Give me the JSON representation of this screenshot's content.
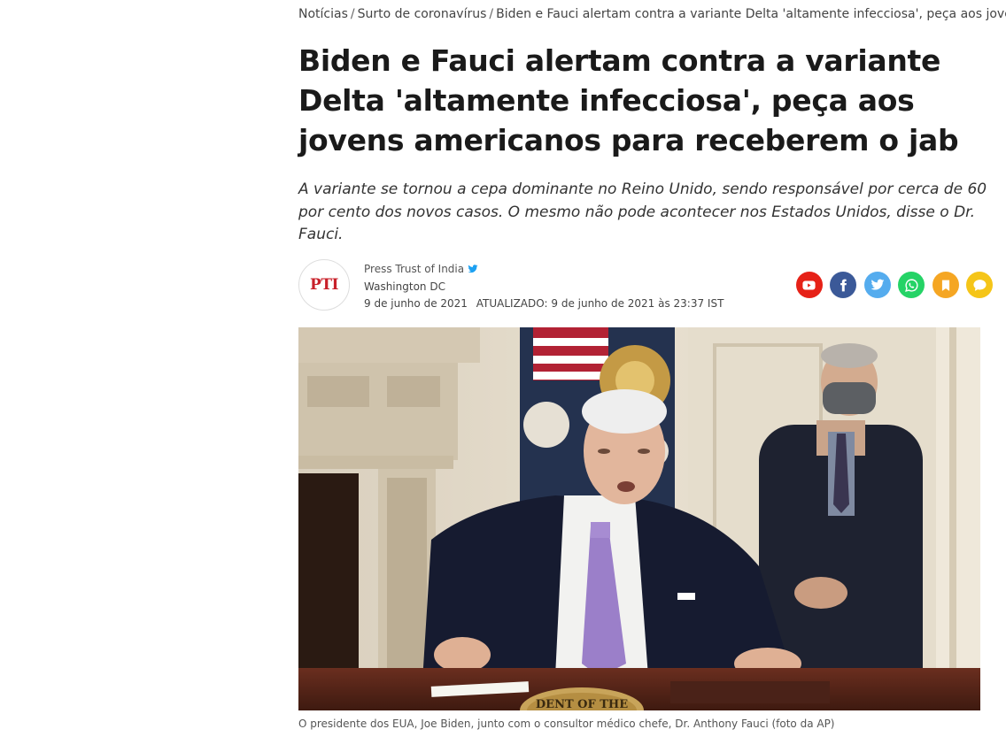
{
  "breadcrumb": {
    "items": [
      "Notícias",
      "Surto de coronavírus",
      "Biden e Fauci alertam contra a variante Delta 'altamente infecciosa', peça aos jovens americanos para receberem o jab"
    ],
    "separator": "/"
  },
  "article": {
    "headline": "Biden e Fauci alertam contra a variante Delta 'altamente infecciosa', peça aos jovens americanos para receberem o jab",
    "summary": "A variante se tornou a cepa dominante no Reino Unido, sendo responsável por cerca de 60 por cento dos novos casos. O mesmo não pode acontecer nos Estados Unidos, disse o Dr. Fauci."
  },
  "byline": {
    "logo_text": "PTI",
    "author": "Press Trust of India",
    "location": "Washington DC",
    "published": "9 de junho de 2021",
    "updated_label": "ATUALIZADO:",
    "updated": "9 de junho de 2021 às 23:37 IST"
  },
  "share": [
    {
      "name": "youtube",
      "icon": "youtube-icon",
      "color": "#e62117"
    },
    {
      "name": "facebook",
      "icon": "facebook-icon",
      "color": "#3b5998"
    },
    {
      "name": "twitter",
      "icon": "twitter-icon",
      "color": "#55acee"
    },
    {
      "name": "whatsapp",
      "icon": "whatsapp-icon",
      "color": "#25d366"
    },
    {
      "name": "bookmark",
      "icon": "bookmark-icon",
      "color": "#f5a623"
    },
    {
      "name": "comment",
      "icon": "comment-icon",
      "color": "#f5c518"
    }
  ],
  "image": {
    "caption": "O presidente dos EUA, Joe Biden, junto com o consultor médico chefe, Dr. Anthony Fauci (foto da AP)",
    "seal_text": "DENT OF THE"
  }
}
